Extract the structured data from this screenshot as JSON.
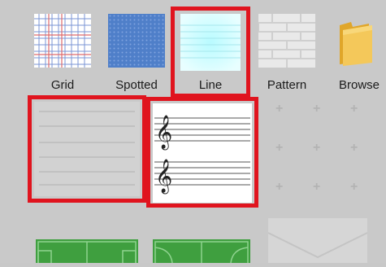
{
  "row1": {
    "items": [
      {
        "label": "Grid",
        "icon": "grid-paper-icon"
      },
      {
        "label": "Spotted",
        "icon": "dotted-paper-icon"
      },
      {
        "label": "Line",
        "icon": "lined-paper-icon",
        "selected": true
      },
      {
        "label": "Pattern",
        "icon": "brick-pattern-icon"
      },
      {
        "label": "Browse",
        "icon": "folder-icon"
      }
    ]
  },
  "row2": {
    "items": [
      {
        "icon": "ruled-lines-icon",
        "selected": true
      },
      {
        "icon": "music-staff-icon",
        "selected": true
      }
    ]
  },
  "row3": {
    "items": [
      {
        "icon": "football-field-icon"
      },
      {
        "icon": "basketball-court-icon"
      },
      {
        "icon": "envelope-icon"
      }
    ]
  },
  "colors": {
    "highlight": "#e0141e",
    "background": "#c9c9c9",
    "grid_line_blue": "#5b7fd6",
    "grid_line_red": "#e05050",
    "spotted_fill": "#4f7fc9",
    "line_fill": "#d8fbff",
    "field_green": "#3f9f3f"
  }
}
